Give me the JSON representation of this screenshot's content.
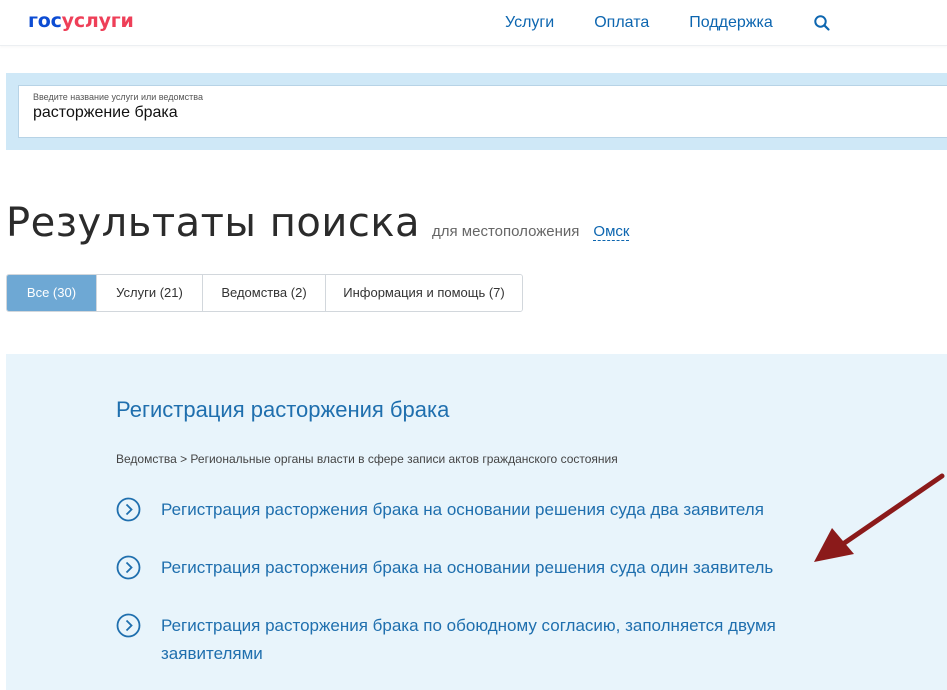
{
  "header": {
    "logo_gos": "гос",
    "logo_uslugi": "услуги",
    "nav": [
      "Услуги",
      "Оплата",
      "Поддержка"
    ]
  },
  "search": {
    "label": "Введите название услуги или ведомства",
    "value": "расторжение брака"
  },
  "results": {
    "title": "Результаты поиска",
    "location_prefix": "для местоположения",
    "city": "Омск"
  },
  "tabs": [
    {
      "label": "Все (30)",
      "active": true
    },
    {
      "label": "Услуги (21)",
      "active": false
    },
    {
      "label": "Ведомства (2)",
      "active": false
    },
    {
      "label": "Информация и помощь (7)",
      "active": false
    }
  ],
  "panel": {
    "title": "Регистрация расторжения брака",
    "breadcrumb": "Ведомства > Региональные органы власти в сфере записи актов гражданского состояния",
    "services": [
      "Регистрация расторжения брака на основании решения суда два заявителя",
      "Регистрация расторжения брака на основании решения суда один заявитель",
      "Регистрация расторжения брака по обоюдному согласию, заполняется двумя заявителями"
    ]
  },
  "colors": {
    "accent": "#1f6fae",
    "tab_active": "#6ea8d4",
    "panel_bg": "#e8f4fb",
    "search_band": "#cfe8f7",
    "arrow": "#8b1a1a"
  },
  "icons": {
    "search": "search-icon",
    "service": "chevron-circle-icon",
    "annotation": "arrow-icon"
  }
}
